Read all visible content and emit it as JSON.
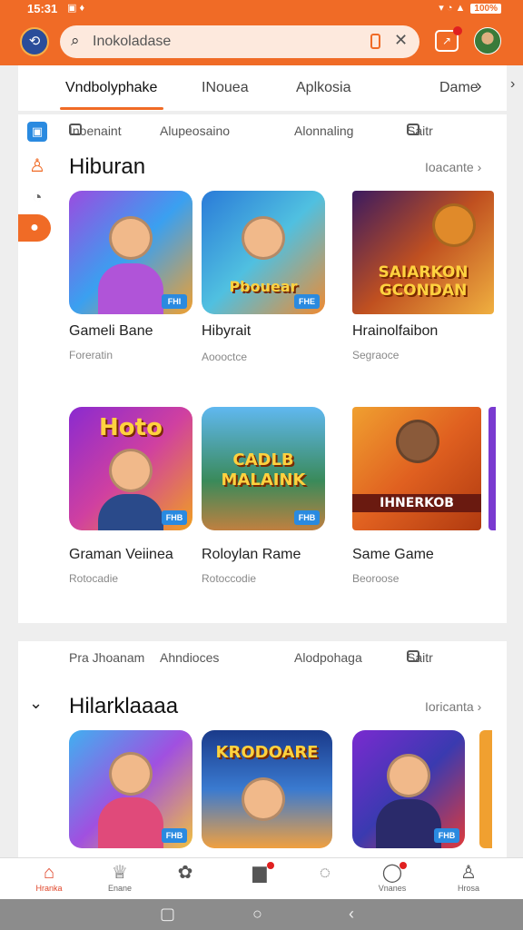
{
  "status": {
    "time": "15:31",
    "battery": "100%"
  },
  "search": {
    "placeholder": "Inokoladase"
  },
  "tabs": [
    {
      "label": "Vndbolyphake"
    },
    {
      "label": "INouea"
    },
    {
      "label": "Aplkosia"
    },
    {
      "label": "Dame"
    }
  ],
  "filters1": {
    "a": "Inoenaint",
    "b": "Alupeosaino",
    "c": "Alonnaling",
    "d": "Saitr"
  },
  "section1": {
    "title": "Hiburan",
    "see_all": "Ioacante",
    "games": [
      {
        "name": "Gameli Bane",
        "sub": "Foreratin",
        "badge": "FHI"
      },
      {
        "name": "Hibyrait",
        "sub": "Aoooctce",
        "badge": "FHE",
        "logo": "Pbouear"
      },
      {
        "name": "Hrainolfaibon",
        "sub": "Segraoce",
        "logo": "SAIARKON GCONDAN"
      },
      {
        "name": "Graman Veiinea",
        "sub": "Rotocadie",
        "badge": "FHB",
        "logo": "Hoto"
      },
      {
        "name": "Roloylan Rame",
        "sub": "Rotoccodie",
        "badge": "FHB",
        "logo": "CADLB MALAINK"
      },
      {
        "name": "Same Game",
        "sub": "Beoroose",
        "logo": "IHNERKOB"
      }
    ]
  },
  "filters2": {
    "a": "Pra Jhoanam",
    "b": "Ahndioces",
    "c": "Alodpohaga",
    "d": "Saitr"
  },
  "section2": {
    "title": "Hilarklaaaa",
    "see_all": "Ioricanta",
    "games": [
      {
        "badge": "FHB"
      },
      {
        "logo": "KRODOARE"
      },
      {
        "badge": "FHB"
      }
    ]
  },
  "nav": [
    {
      "label": "Hranka"
    },
    {
      "label": "Enane"
    },
    {
      "label": ""
    },
    {
      "label": ""
    },
    {
      "label": ""
    },
    {
      "label": "Vnanes"
    },
    {
      "label": "Hrosa"
    }
  ],
  "colors": {
    "accent": "#f06b26",
    "badge": "#2a8ae0"
  }
}
